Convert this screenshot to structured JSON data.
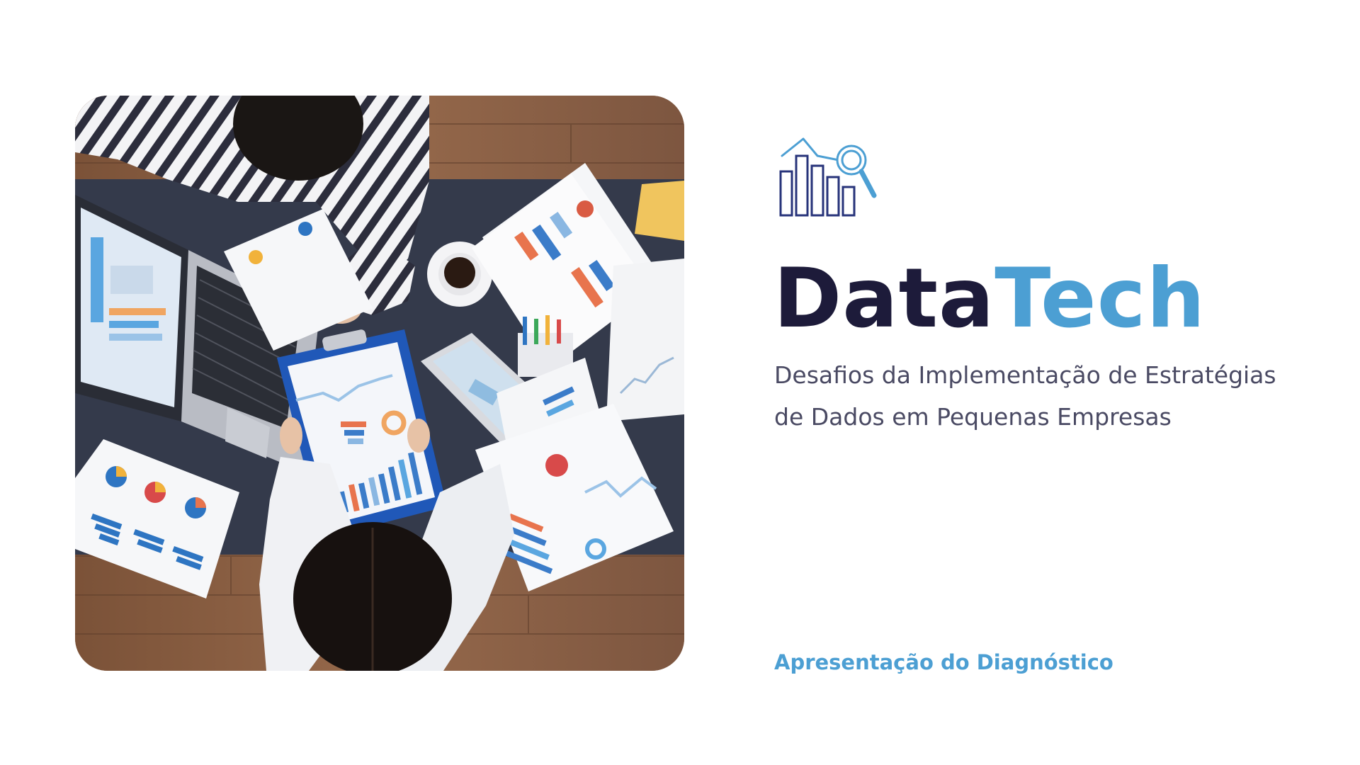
{
  "slide": {
    "brand": {
      "part1": "Data",
      "part2": "Tech"
    },
    "subtitle": "Desafios da Implementação de Estratégias de Dados em Pequenas Empresas",
    "footer_label": "Apresentação do Diagnóstico",
    "logo_icon": "bar-chart-magnifier-icon",
    "photo_subject": "people-analyzing-charts-photo",
    "colors": {
      "brand_dark": "#1d1b3a",
      "brand_accent": "#4c9fd3",
      "subtitle": "#4a4a63",
      "icon_dark": "#27337a",
      "icon_light": "#4c9fd3"
    }
  }
}
